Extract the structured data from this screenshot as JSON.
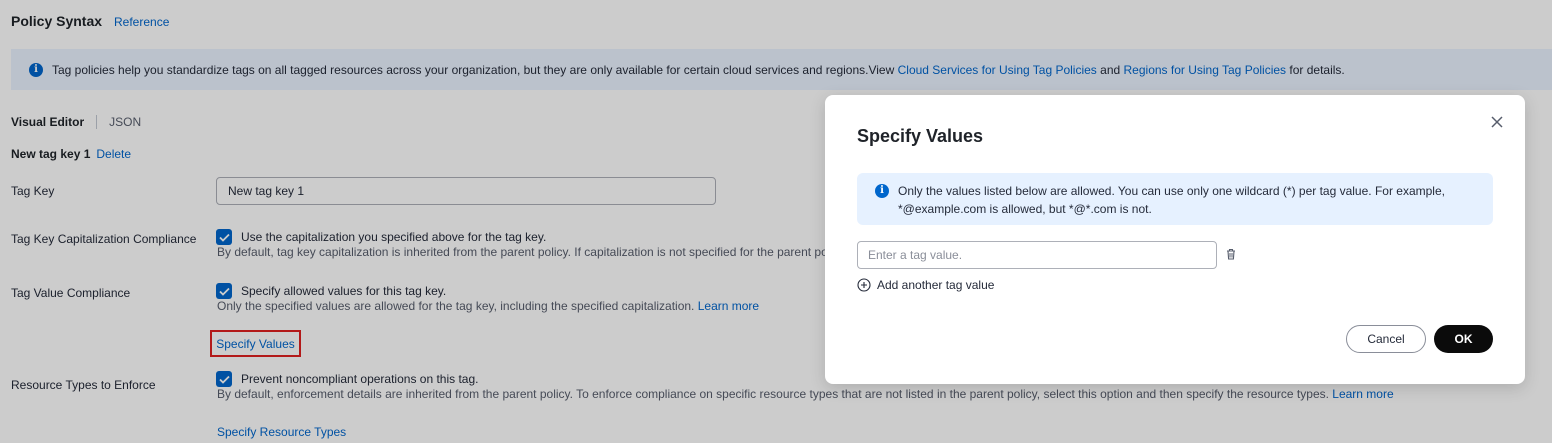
{
  "header": {
    "title": "Policy Syntax",
    "reference_link": "Reference"
  },
  "info_bar": {
    "text": "Tag policies help you standardize tags on all tagged resources across your organization, but they are only available for certain cloud services and regions.View ",
    "link1": "Cloud Services for Using Tag Policies",
    "and": " and ",
    "link2": "Regions for Using Tag Policies",
    "suffix": " for details."
  },
  "editor_tabs": {
    "visual": "Visual Editor",
    "json": "JSON"
  },
  "tag_key_section": {
    "title": "New tag key 1",
    "delete": "Delete",
    "tag_key_label": "Tag Key",
    "tag_key_value": "New tag key 1",
    "cap_label": "Tag Key Capitalization Compliance",
    "cap_check": "Use the capitalization you specified above for the tag key.",
    "cap_desc": "By default, tag key capitalization is inherited from the parent policy. If capitalization is not specified for the parent po",
    "value_label": "Tag Value Compliance",
    "value_check": "Specify allowed values for this tag key.",
    "value_desc": "Only the specified values are allowed for the tag key, including the specified capitalization. ",
    "value_learn_more": "Learn more",
    "specify_values": "Specify Values",
    "resource_label": "Resource Types to Enforce",
    "resource_check": "Prevent noncompliant operations on this tag.",
    "resource_desc": "By default, enforcement details are inherited from the parent policy. To enforce compliance on specific resource types that are not listed in the parent policy, select this option and then specify the resource types. ",
    "resource_learn_more": "Learn more",
    "specify_resource_types": "Specify Resource Types"
  },
  "dialog": {
    "title": "Specify Values",
    "info_line1": "Only the values listed below are allowed. You can use only one wildcard (*) per tag value. For example,",
    "info_line2": "*@example.com is allowed, but *@*.com is not.",
    "input_placeholder": "Enter a tag value.",
    "add_another": "Add another tag value",
    "cancel": "Cancel",
    "ok": "OK"
  },
  "colors": {
    "link": "#0066cc",
    "info_bg": "#eaf3ff",
    "checkbox": "#0066cc",
    "highlight_border": "#e02020",
    "ok_button": "#0b0b0b"
  }
}
